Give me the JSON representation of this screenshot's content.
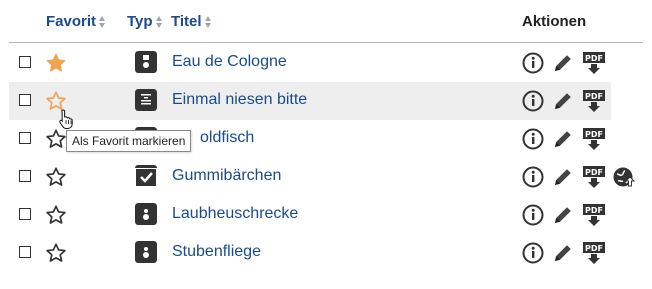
{
  "header": {
    "favorit": "Favorit",
    "typ": "Typ",
    "titel": "Titel",
    "aktionen": "Aktionen"
  },
  "rows": [
    {
      "title": "Eau de Cologne",
      "favorite": true,
      "type_icon": "device-icon"
    },
    {
      "title": "Einmal niesen bitte",
      "favorite": false,
      "type_icon": "list-document-icon"
    },
    {
      "title": "oldfisch",
      "favorite": false,
      "type_icon": "device-icon"
    },
    {
      "title": "Gummibärchen",
      "favorite": false,
      "type_icon": "checkbox-icon"
    },
    {
      "title": "Laubheuschrecke",
      "favorite": false,
      "type_icon": "device-icon"
    },
    {
      "title": "Stubenfliege",
      "favorite": false,
      "type_icon": "device-icon"
    }
  ],
  "tooltip": "Als Favorit markieren",
  "colors": {
    "link": "#1a4b8c",
    "star_filled": "#f0a350",
    "star_outline": "#333333",
    "row_hover": "#eeeeee",
    "icon_dark": "#333333"
  },
  "icons": {
    "info": "info-icon",
    "edit": "pencil-icon",
    "pdf": "pdf-download-icon",
    "globe": "globe-upload-icon"
  },
  "pdf_label": "PDF"
}
